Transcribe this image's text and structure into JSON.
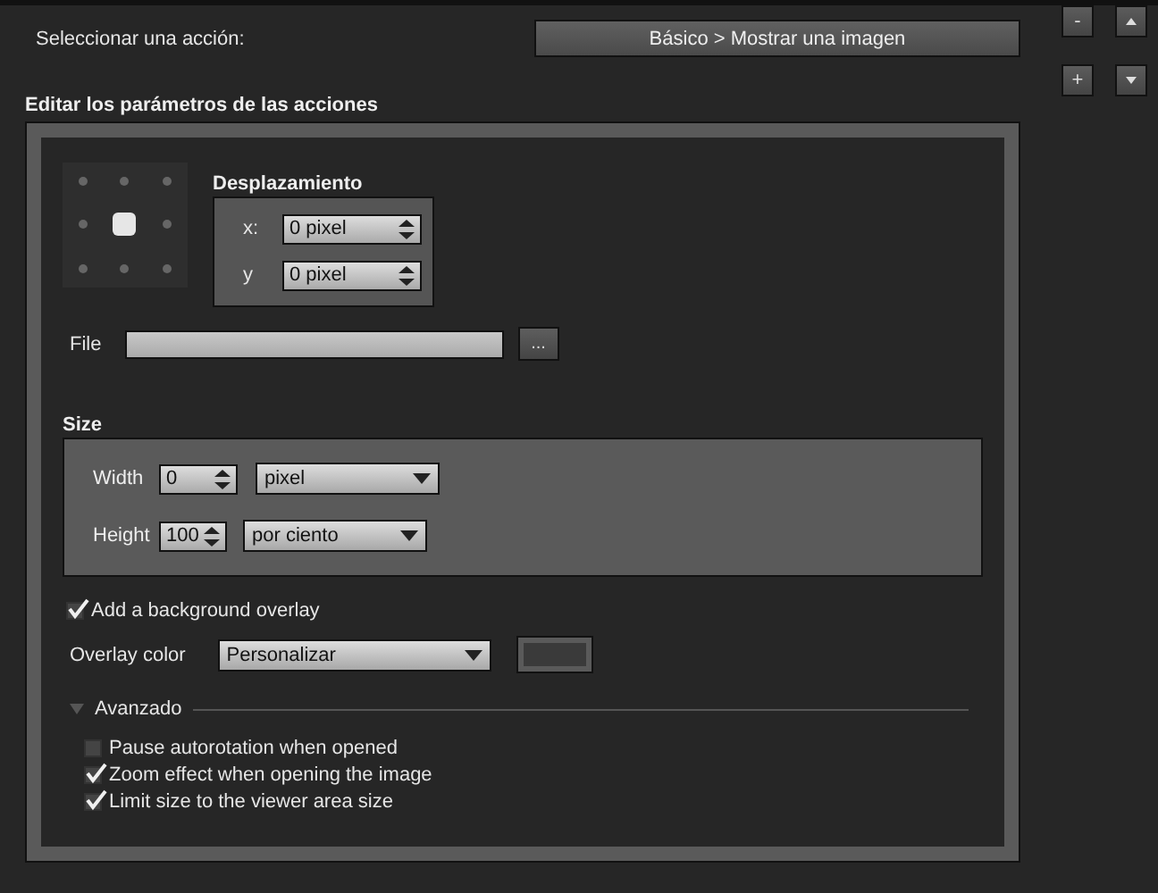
{
  "action_select": {
    "label": "Seleccionar una acción:",
    "value": "Básico > Mostrar una imagen"
  },
  "side_buttons": [
    {
      "kind": "text",
      "label": "-"
    },
    {
      "kind": "up"
    },
    {
      "kind": "text",
      "label": "+"
    },
    {
      "kind": "down"
    }
  ],
  "parameters": {
    "title": "Editar los parámetros de las acciones",
    "anchor": [
      {
        "selected": false
      },
      {
        "selected": false
      },
      {
        "selected": false
      },
      {
        "selected": false
      },
      {
        "selected": true
      },
      {
        "selected": false
      },
      {
        "selected": false
      },
      {
        "selected": false
      },
      {
        "selected": false
      }
    ],
    "offset": {
      "title": "Desplazamiento",
      "fields": [
        {
          "label": "x:",
          "value": "0 pixel"
        },
        {
          "label": "y",
          "value": "0 pixel"
        }
      ]
    },
    "file": {
      "label": "File",
      "browse": "..."
    },
    "size": {
      "title": "Size",
      "rows": [
        {
          "label": "Width",
          "value": "0",
          "unit": "pixel"
        },
        {
          "label": "Height",
          "value": "100",
          "unit": "por ciento"
        }
      ]
    },
    "overlay": {
      "label": "Add a background overlay",
      "checked": true
    },
    "overlay_color": {
      "label": "Overlay color",
      "value": "Personalizar"
    },
    "advanced": {
      "title": "Avanzado",
      "expanded": true,
      "options": [
        {
          "label": "Pause autorotation when opened",
          "checked": false
        },
        {
          "label": "Zoom effect when opening the image",
          "checked": true
        },
        {
          "label": "Limit size to the viewer area size",
          "checked": true
        }
      ]
    }
  }
}
